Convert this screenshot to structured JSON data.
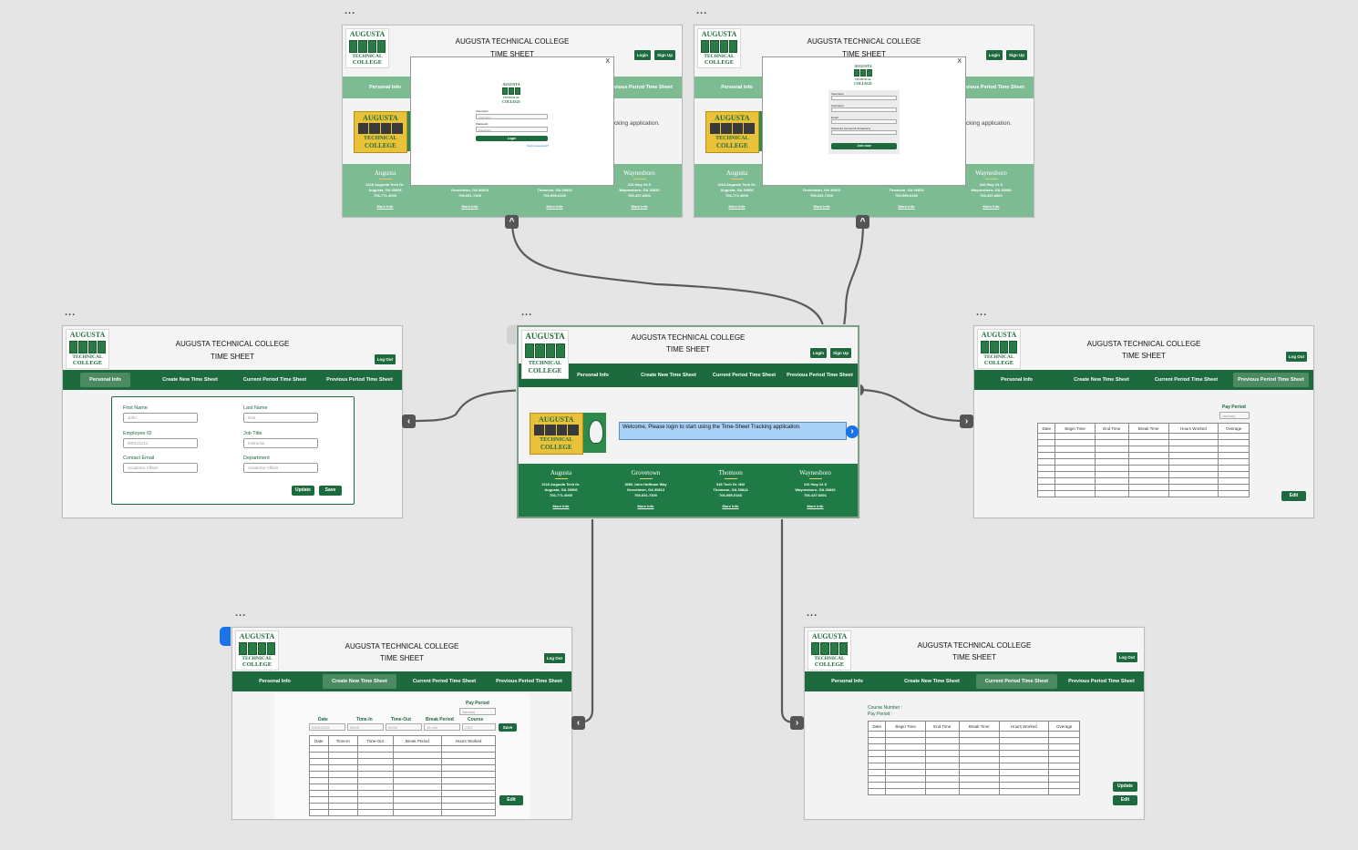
{
  "dots": "...",
  "brand": {
    "w1": "AUGUSTA",
    "w2": "TECHNICAL",
    "w3": "COLLEGE"
  },
  "app": {
    "title": "AUGUSTA TECHNICAL COLLEGE",
    "subtitle": "TIME SHEET"
  },
  "nav": [
    "Personal Info",
    "Create New Time Sheet",
    "Current Period Time Sheet",
    "Previous Period Time Sheet"
  ],
  "buttons": {
    "login": "Login",
    "signup": "Sign Up",
    "logout": "Log Out",
    "update": "Update",
    "save": "Save",
    "edit": "Edit",
    "join": "Join now",
    "close": "X"
  },
  "welcome": "Welcome, Please login to start using the Time-Sheet Tracking application.",
  "welcome_partial": "cking application.",
  "campuses": [
    {
      "name": "Augusta",
      "addr": "3116 Augusta Tech Dr.",
      "city": "Augusta, GA 30906",
      "phone": "706-771-4000",
      "more": "More Info"
    },
    {
      "name": "Grovetown",
      "addr": "3066 John Hoffman Way",
      "city": "Grovetown, GA 30813",
      "phone": "706-651-7300",
      "more": "More Info"
    },
    {
      "name": "Thomson",
      "addr": "343 Tech Dr. NW",
      "city": "Thomson, GA 30824",
      "phone": "706-595-0166",
      "more": "More Info"
    },
    {
      "name": "Waynesboro",
      "addr": "216 Hwy 24 S",
      "city": "Waynesboro, GA 30830",
      "phone": "706-437-6801",
      "more": "More Info"
    }
  ],
  "login_form": {
    "username": "Username",
    "username_ph": "Username",
    "password": "Password",
    "password_ph": "Password",
    "forgot": "Forgot password?"
  },
  "signup_form": {
    "l1": "Username",
    "l2": "Username",
    "l3": "Email",
    "l4": "Password (at least 8 characters)"
  },
  "personal": {
    "first_name": "First Name",
    "first_name_val": "John",
    "last_name": "Last Name",
    "last_name_val": "Doe",
    "employee_id": "Employee ID",
    "employee_id_val": "900121212",
    "job_title": "Job Title",
    "job_title_val": "Instructor",
    "email": "Contact Email",
    "email_val": "Academic Affairs",
    "department": "Department",
    "department_val": "Academic Affairs"
  },
  "create": {
    "pay_period": "Pay Period",
    "pay_period_val": "January",
    "form_cols": [
      "Date",
      "Time-In",
      "Time-Out",
      "Break Period",
      "Course"
    ],
    "form_vals": [
      "01/01/2021",
      "08:00",
      "09:00",
      "15 min",
      "CIST"
    ],
    "table_cols": [
      "Date",
      "Time-In",
      "Time-Out",
      "Break Period",
      "Hours Worked"
    ]
  },
  "current": {
    "course_number": "Course Number :",
    "pay_period": "Pay Period :",
    "table_cols": [
      "Date",
      "Begin Time",
      "End Time",
      "Break Time",
      "Hours Worked",
      "Overage"
    ]
  },
  "previous": {
    "pay_period": "Pay Period",
    "pay_period_val": "January",
    "table_cols": [
      "Date",
      "Begin Time",
      "End Time",
      "Break Time",
      "Hours Worked",
      "Overage"
    ]
  },
  "icons": {
    "up": "^",
    "left": "‹",
    "right": "›"
  },
  "colors": {
    "brand_green": "#1d6a3f",
    "light_green": "#7dbb93",
    "canvas": "#e5e5e5",
    "connector": "#555555",
    "selection_blue": "#1a73e8"
  }
}
